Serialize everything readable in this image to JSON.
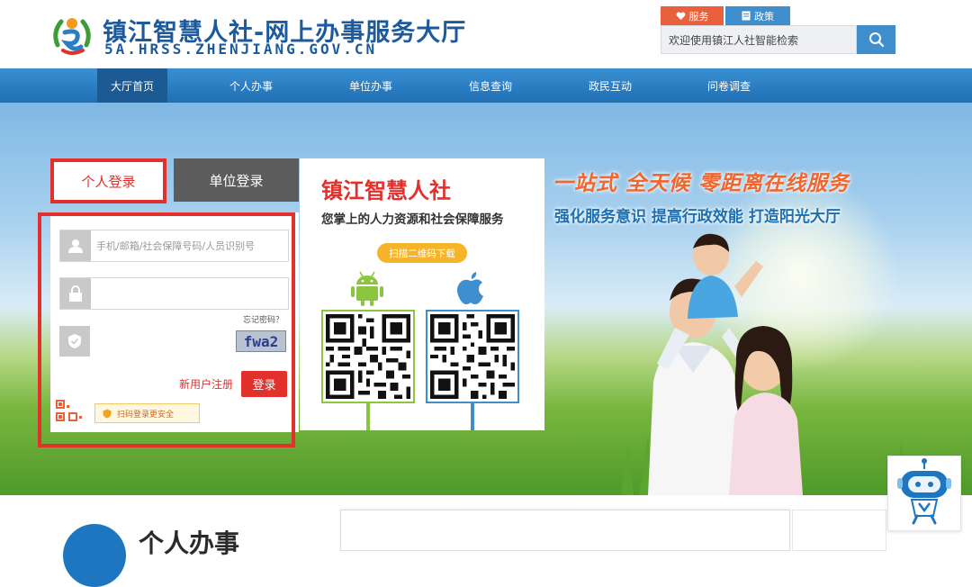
{
  "header": {
    "title": "镇江智慧人社-网上办事服务大厅",
    "url": "5A.HRSS.ZHENJIANG.GOV.CN",
    "service_label": "服务",
    "policy_label": "政策",
    "search_placeholder": "欢迎使用镇江人社智能检索"
  },
  "nav": {
    "items": [
      {
        "label": "大厅首页",
        "active": true
      },
      {
        "label": "个人办事",
        "active": false
      },
      {
        "label": "单位办事",
        "active": false
      },
      {
        "label": "信息查询",
        "active": false
      },
      {
        "label": "政民互动",
        "active": false
      },
      {
        "label": "问卷调查",
        "active": false
      }
    ]
  },
  "hero": {
    "slogan1": "一站式  全天候  零距离在线服务",
    "slogan2": "强化服务意识  提高行政效能  打造阳光大厅"
  },
  "login": {
    "tab_personal": "个人登录",
    "tab_company": "单位登录",
    "username_placeholder": "手机/邮箱/社会保障号码/人员识别号",
    "password_placeholder": "",
    "forgot_password": "忘记密码？",
    "captcha_text": "fwa2",
    "register_link": "新用户注册",
    "login_button": "登录",
    "scan_tip": "扫码登录更安全"
  },
  "app_download": {
    "title": "镇江智慧人社",
    "subtitle": "您掌上的人力资源和社会保障服务",
    "scan_button": "扫描二维码下载"
  },
  "bottom": {
    "section_title": "个人办事"
  },
  "colors": {
    "brand_blue": "#1d5a9c",
    "nav_blue": "#2a7fc4",
    "accent_red": "#e2302c",
    "accent_orange": "#f0662f"
  }
}
